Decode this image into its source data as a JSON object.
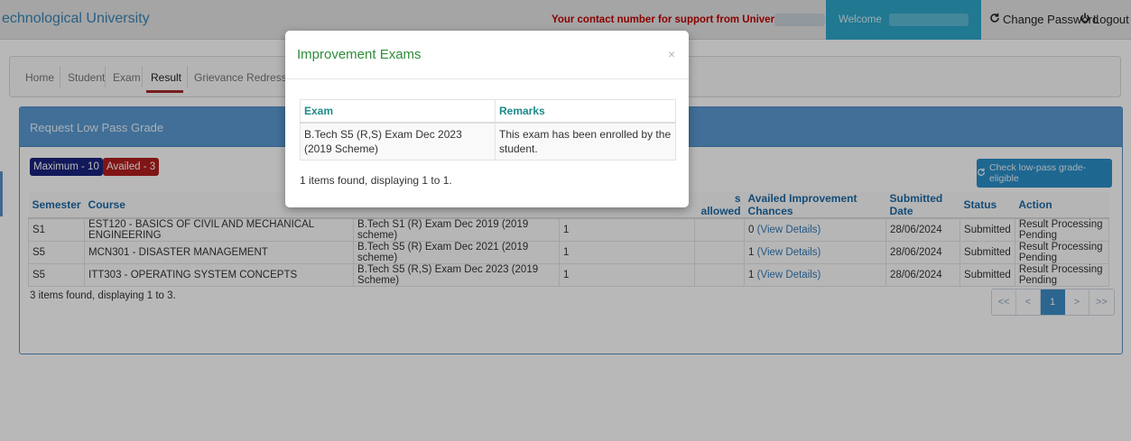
{
  "header": {
    "brand": "echnological University",
    "support_text": "Your contact number for support from University is :",
    "welcome": "Welcome",
    "change_password": "Change Password",
    "logout": "Logout"
  },
  "nav": {
    "tabs": [
      "Home",
      "Student",
      "Exam",
      "Result",
      "Grievance Redressal T"
    ],
    "active": "Result"
  },
  "panel": {
    "title": "Request Low Pass Grade",
    "badge_max": "Maximum - 10",
    "badge_availed": "Availed - 3",
    "check_button": "Check low-pass grade-eligible"
  },
  "table": {
    "headers": [
      "Semester",
      "Course",
      "",
      "",
      "s allowed",
      "Availed Improvement Chances",
      "Submitted Date",
      "Status",
      "Action"
    ],
    "rows": [
      [
        "S1",
        "EST120 - BASICS OF CIVIL AND MECHANICAL ENGINEERING",
        "B.Tech S1 (R) Exam Dec 2019 (2019 scheme)",
        "1",
        "",
        "0",
        "(View Details)",
        "28/06/2024",
        "Submitted",
        "Result Processing Pending"
      ],
      [
        "S5",
        "MCN301 - DISASTER MANAGEMENT",
        "B.Tech S5 (R) Exam Dec 2021 (2019 scheme)",
        "1",
        "",
        "1",
        "(View Details)",
        "28/06/2024",
        "Submitted",
        "Result Processing Pending"
      ],
      [
        "S5",
        "ITT303 - OPERATING SYSTEM CONCEPTS",
        "B.Tech S5 (R,S) Exam Dec 2023 (2019 Scheme)",
        "1",
        "",
        "1",
        "(View Details)",
        "28/06/2024",
        "Submitted",
        "Result Processing Pending"
      ]
    ],
    "items_count": "3 items found, displaying 1 to 3."
  },
  "pager": {
    "first": "<<",
    "prev": "<",
    "current": "1",
    "next": ">",
    "last": ">>"
  },
  "modal": {
    "title": "Improvement Exams",
    "close": "×",
    "col_exam": "Exam",
    "col_remarks": "Remarks",
    "exam_value": "B.Tech S5 (R,S) Exam Dec 2023 (2019 Scheme)",
    "remarks_value": "This exam has been enrolled by the student.",
    "items_count": "1 items found, displaying 1 to 1."
  }
}
